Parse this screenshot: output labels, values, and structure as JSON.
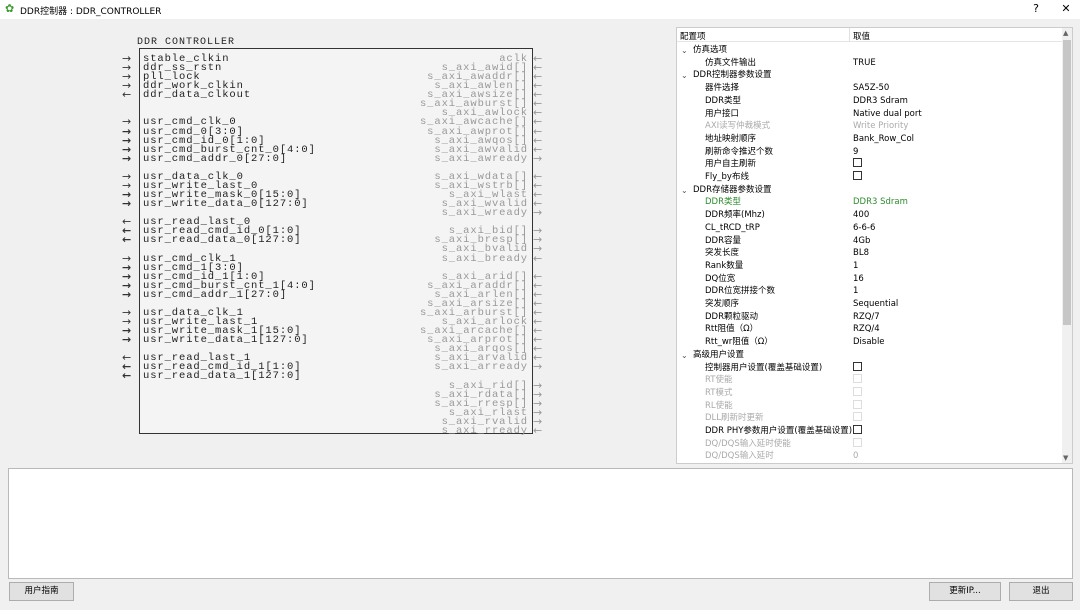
{
  "window": {
    "title": "DDR控制器 : DDR_CONTROLLER",
    "help_label": "?",
    "close_label": "✕"
  },
  "symbol": {
    "title": "DDR CONTROLLER",
    "left_groups": [
      [
        {
          "n": "stable_clkin",
          "d": "in"
        },
        {
          "n": "ddr_ss_rstn",
          "d": "in"
        },
        {
          "n": "pll_lock",
          "d": "in"
        },
        {
          "n": "ddr_work_clkin",
          "d": "in"
        },
        {
          "n": "ddr_data_clkout",
          "d": "out"
        }
      ],
      [],
      [
        {
          "n": "usr_cmd_clk_0",
          "d": "in"
        },
        {
          "n": "usr_cmd_0[3:0]",
          "d": "in",
          "bus": true
        },
        {
          "n": "usr_cmd_id_0[1:0]",
          "d": "in",
          "bus": true
        },
        {
          "n": "usr_cmd_burst_cnt_0[4:0]",
          "d": "in",
          "bus": true
        },
        {
          "n": "usr_cmd_addr_0[27:0]",
          "d": "in",
          "bus": true
        }
      ],
      [
        {
          "n": "usr_data_clk_0",
          "d": "in"
        },
        {
          "n": "usr_write_last_0",
          "d": "in"
        },
        {
          "n": "usr_write_mask_0[15:0]",
          "d": "in",
          "bus": true
        },
        {
          "n": "usr_write_data_0[127:0]",
          "d": "in",
          "bus": true
        }
      ],
      [
        {
          "n": "usr_read_last_0",
          "d": "out"
        },
        {
          "n": "usr_read_cmd_id_0[1:0]",
          "d": "out",
          "bus": true
        },
        {
          "n": "usr_read_data_0[127:0]",
          "d": "out",
          "bus": true
        }
      ],
      [
        {
          "n": "usr_cmd_clk_1",
          "d": "in"
        },
        {
          "n": "usr_cmd_1[3:0]",
          "d": "in",
          "bus": true
        },
        {
          "n": "usr_cmd_id_1[1:0]",
          "d": "in",
          "bus": true
        },
        {
          "n": "usr_cmd_burst_cnt_1[4:0]",
          "d": "in",
          "bus": true
        },
        {
          "n": "usr_cmd_addr_1[27:0]",
          "d": "in",
          "bus": true
        }
      ],
      [
        {
          "n": "usr_data_clk_1",
          "d": "in"
        },
        {
          "n": "usr_write_last_1",
          "d": "in"
        },
        {
          "n": "usr_write_mask_1[15:0]",
          "d": "in",
          "bus": true
        },
        {
          "n": "usr_write_data_1[127:0]",
          "d": "in",
          "bus": true
        }
      ],
      [
        {
          "n": "usr_read_last_1",
          "d": "out"
        },
        {
          "n": "usr_read_cmd_id_1[1:0]",
          "d": "out",
          "bus": true
        },
        {
          "n": "usr_read_data_1[127:0]",
          "d": "out",
          "bus": true
        }
      ]
    ],
    "right_groups": [
      [
        {
          "n": "aclk",
          "d": "in"
        },
        {
          "n": "s_axi_awid[]",
          "d": "in"
        },
        {
          "n": "s_axi_awaddr[]",
          "d": "in"
        },
        {
          "n": "s_axi_awlen[]",
          "d": "in"
        },
        {
          "n": "s_axi_awsize[]",
          "d": "in"
        },
        {
          "n": "s_axi_awburst[]",
          "d": "in"
        },
        {
          "n": "s_axi_awlock",
          "d": "in"
        },
        {
          "n": "s_axi_awcache[]",
          "d": "in"
        },
        {
          "n": "s_axi_awprot[]",
          "d": "in"
        },
        {
          "n": "s_axi_awqos[]",
          "d": "in"
        },
        {
          "n": "s_axi_awvalid",
          "d": "in"
        },
        {
          "n": "s_axi_awready",
          "d": "out"
        }
      ],
      [
        {
          "n": "s_axi_wdata[]",
          "d": "in"
        },
        {
          "n": "s_axi_wstrb[]",
          "d": "in"
        },
        {
          "n": "s_axi_wlast",
          "d": "in"
        },
        {
          "n": "s_axi_wvalid",
          "d": "in"
        },
        {
          "n": "s_axi_wready",
          "d": "out"
        }
      ],
      [
        {
          "n": "s_axi_bid[]",
          "d": "out"
        },
        {
          "n": "s_axi_bresp[]",
          "d": "out"
        },
        {
          "n": "s_axi_bvalid",
          "d": "out"
        },
        {
          "n": "s_axi_bready",
          "d": "in"
        }
      ],
      [
        {
          "n": "s_axi_arid[]",
          "d": "in"
        },
        {
          "n": "s_axi_araddr[]",
          "d": "in"
        },
        {
          "n": "s_axi_arlen[]",
          "d": "in"
        },
        {
          "n": "s_axi_arsize[]",
          "d": "in"
        },
        {
          "n": "s_axi_arburst[]",
          "d": "in"
        },
        {
          "n": "s_axi_arlock",
          "d": "in"
        },
        {
          "n": "s_axi_arcache[]",
          "d": "in"
        },
        {
          "n": "s_axi_arprot[]",
          "d": "in"
        },
        {
          "n": "s_axi_arqos[]",
          "d": "in"
        },
        {
          "n": "s_axi_arvalid",
          "d": "in"
        },
        {
          "n": "s_axi_arready",
          "d": "out"
        }
      ],
      [
        {
          "n": "s_axi_rid[]",
          "d": "out"
        },
        {
          "n": "s_axi_rdata[]",
          "d": "out"
        },
        {
          "n": "s_axi_rresp[]",
          "d": "out"
        },
        {
          "n": "s_axi_rlast",
          "d": "out"
        },
        {
          "n": "s_axi_rvalid",
          "d": "out"
        },
        {
          "n": "s_axi_rready",
          "d": "in"
        }
      ]
    ]
  },
  "config": {
    "col_key": "配置项",
    "col_value": "取值",
    "rows": [
      {
        "t": "group",
        "k": "仿真选项"
      },
      {
        "k": "仿真文件输出",
        "v": "TRUE"
      },
      {
        "t": "group",
        "k": "DDR控制器参数设置"
      },
      {
        "k": "器件选择",
        "v": "SA5Z-50"
      },
      {
        "k": "DDR类型",
        "v": "DDR3 Sdram"
      },
      {
        "k": "用户接口",
        "v": "Native dual port"
      },
      {
        "k": "AXI读写仲裁模式",
        "v": "Write Priority",
        "dis": true
      },
      {
        "k": "地址映射顺序",
        "v": "Bank_Row_Col"
      },
      {
        "k": "刷新命令推迟个数",
        "v": "9"
      },
      {
        "k": "用户自主刷新",
        "cb": true
      },
      {
        "k": "Fly_by布线",
        "cb": true
      },
      {
        "t": "group",
        "k": "DDR存储器参数设置"
      },
      {
        "k": "DDR类型",
        "v": "DDR3 Sdram",
        "hl": true
      },
      {
        "k": "DDR频率(Mhz)",
        "v": "400"
      },
      {
        "k": "CL_tRCD_tRP",
        "v": "6-6-6"
      },
      {
        "k": "DDR容量",
        "v": "4Gb"
      },
      {
        "k": "突发长度",
        "v": "BL8"
      },
      {
        "k": "Rank数量",
        "v": "1"
      },
      {
        "k": "DQ位宽",
        "v": "16"
      },
      {
        "k": "DDR位宽拼接个数",
        "v": "1"
      },
      {
        "k": "突发顺序",
        "v": "Sequential"
      },
      {
        "k": "DDR颗粒驱动",
        "v": "RZQ/7"
      },
      {
        "k": "Rtt阻值（Ω）",
        "v": "RZQ/4"
      },
      {
        "k": "Rtt_wr阻值（Ω）",
        "v": "Disable"
      },
      {
        "t": "group",
        "k": "高级用户设置"
      },
      {
        "k": "控制器用户设置(覆盖基础设置)",
        "cb": true
      },
      {
        "k": "RT使能",
        "cb": true,
        "dis": true
      },
      {
        "k": "RT模式",
        "cb": true,
        "dis": true
      },
      {
        "k": "RL使能",
        "cb": true,
        "dis": true
      },
      {
        "k": "DLL刷新时更新",
        "cb": true,
        "dis": true
      },
      {
        "k": "DDR PHY参数用户设置(覆盖基础设置)",
        "cb": true
      },
      {
        "k": "DQ/DQS输入延时使能",
        "cb": true,
        "dis": true
      },
      {
        "k": "DQ/DQS输入延时",
        "v": "0",
        "dis": true
      }
    ]
  },
  "output_text": "",
  "buttons": {
    "guide": "用户指南",
    "update": "更新IP...",
    "exit": "退出"
  }
}
